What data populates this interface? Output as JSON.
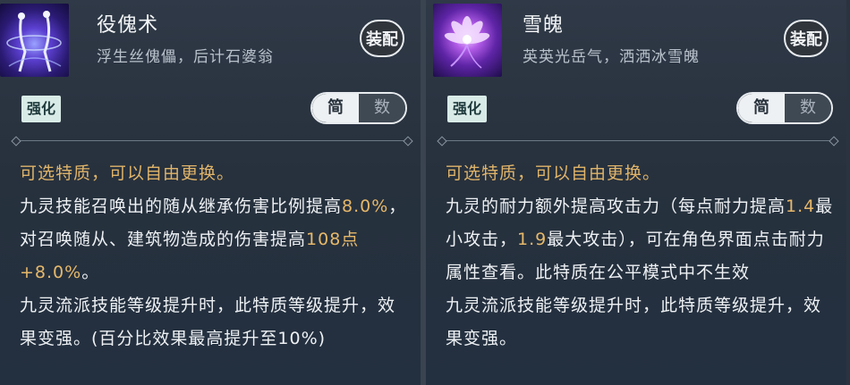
{
  "left": {
    "title": "役傀术",
    "subtitle": "浮生丝傀儡，后计石婆翁",
    "equip_label": "装配",
    "tag_label": "强化",
    "toggle": {
      "on": "简",
      "off": "数"
    },
    "lines": {
      "intro": "可选特质，可以自由更换。",
      "p1_a": "九灵技能召唤出的随从继承伤害比例提高",
      "p1_num1": "8.0%",
      "p1_b": "，对召唤随从、建筑物造成的伤害提高",
      "p1_num2": "108点+8.0%",
      "p1_c": "。",
      "p2": "九灵流派技能等级提升时，此特质等级提升，效果变强。(百分比效果最高提升至10%)"
    }
  },
  "right": {
    "title": "雪魄",
    "subtitle": "英英光岳气，洒洒冰雪魄",
    "equip_label": "装配",
    "tag_label": "强化",
    "toggle": {
      "on": "简",
      "off": "数"
    },
    "lines": {
      "intro": "可选特质，可以自由更换。",
      "p1_a": "九灵的耐力额外提高攻击力（每点耐力提高",
      "p1_num1": "1.4",
      "p1_b": "最小攻击，",
      "p1_num2": "1.9",
      "p1_c": "最大攻击），可在角色界面点击耐力属性查看。此特质在公平模式中不生效",
      "p2": "九灵流派技能等级提升时，此特质等级提升，效果变强。"
    }
  },
  "colors": {
    "highlight": "#e0b46a",
    "text": "#eef1f4",
    "panel": "#2f3947"
  }
}
